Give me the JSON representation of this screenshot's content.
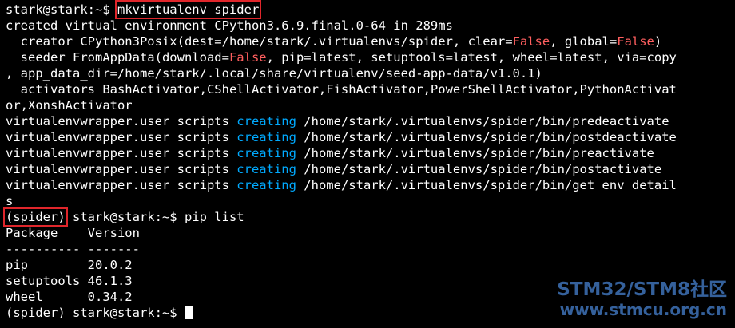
{
  "terminal": {
    "lines": [
      [
        {
          "t": "stark@stark:~$ "
        },
        {
          "t": "mkvirtualenv spider",
          "box": true
        }
      ],
      [
        {
          "t": "created virtual environment CPython3.6.9.final.0-64 in 289ms"
        }
      ],
      [
        {
          "t": "  creator CPython3Posix(dest=/home/stark/.virtualenvs/spider, clear="
        },
        {
          "t": "False",
          "c": "red"
        },
        {
          "t": ", global="
        },
        {
          "t": "False",
          "c": "red"
        },
        {
          "t": ")"
        }
      ],
      [
        {
          "t": "  seeder FromAppData(download="
        },
        {
          "t": "False",
          "c": "red"
        },
        {
          "t": ", pip=latest, setuptools=latest, wheel=latest, via=copy"
        }
      ],
      [
        {
          "t": ", app_data_dir=/home/stark/.local/share/virtualenv/seed-app-data/v1.0.1)"
        }
      ],
      [
        {
          "t": "  activators BashActivator,CShellActivator,FishActivator,PowerShellActivator,PythonActivat"
        }
      ],
      [
        {
          "t": "or,XonshActivator"
        }
      ],
      [
        {
          "t": "virtualenvwrapper.user_scripts "
        },
        {
          "t": "creating",
          "c": "cyan"
        },
        {
          "t": " /home/stark/.virtualenvs/spider/bin/predeactivate"
        }
      ],
      [
        {
          "t": "virtualenvwrapper.user_scripts "
        },
        {
          "t": "creating",
          "c": "cyan"
        },
        {
          "t": " /home/stark/.virtualenvs/spider/bin/postdeactivate"
        }
      ],
      [
        {
          "t": "virtualenvwrapper.user_scripts "
        },
        {
          "t": "creating",
          "c": "cyan"
        },
        {
          "t": " /home/stark/.virtualenvs/spider/bin/preactivate"
        }
      ],
      [
        {
          "t": "virtualenvwrapper.user_scripts "
        },
        {
          "t": "creating",
          "c": "cyan"
        },
        {
          "t": " /home/stark/.virtualenvs/spider/bin/postactivate"
        }
      ],
      [
        {
          "t": "virtualenvwrapper.user_scripts "
        },
        {
          "t": "creating",
          "c": "cyan"
        },
        {
          "t": " /home/stark/.virtualenvs/spider/bin/get_env_detail"
        }
      ],
      [
        {
          "t": "s"
        }
      ],
      [
        {
          "t": "(spider)",
          "box": true
        },
        {
          "t": " stark@stark:~$ pip list"
        }
      ],
      [
        {
          "t": "Package    Version"
        }
      ],
      [
        {
          "t": "---------- -------"
        }
      ],
      [
        {
          "t": "pip        20.0.2"
        }
      ],
      [
        {
          "t": "setuptools 46.1.3"
        }
      ],
      [
        {
          "t": "wheel      0.34.2"
        }
      ],
      [
        {
          "t": "(spider) stark@stark:~$ "
        },
        {
          "cursor": true
        }
      ]
    ]
  },
  "colors": {
    "background": "#000000",
    "text": "#ffffff",
    "keyword_false": "#ff5f5f",
    "keyword_creating": "#00aaff",
    "highlight_box": "#e0262b",
    "watermark": "#3f73b8"
  },
  "watermark": {
    "line1": "STM32/STM8社区",
    "line2": "www.stmcu.org.cn"
  }
}
